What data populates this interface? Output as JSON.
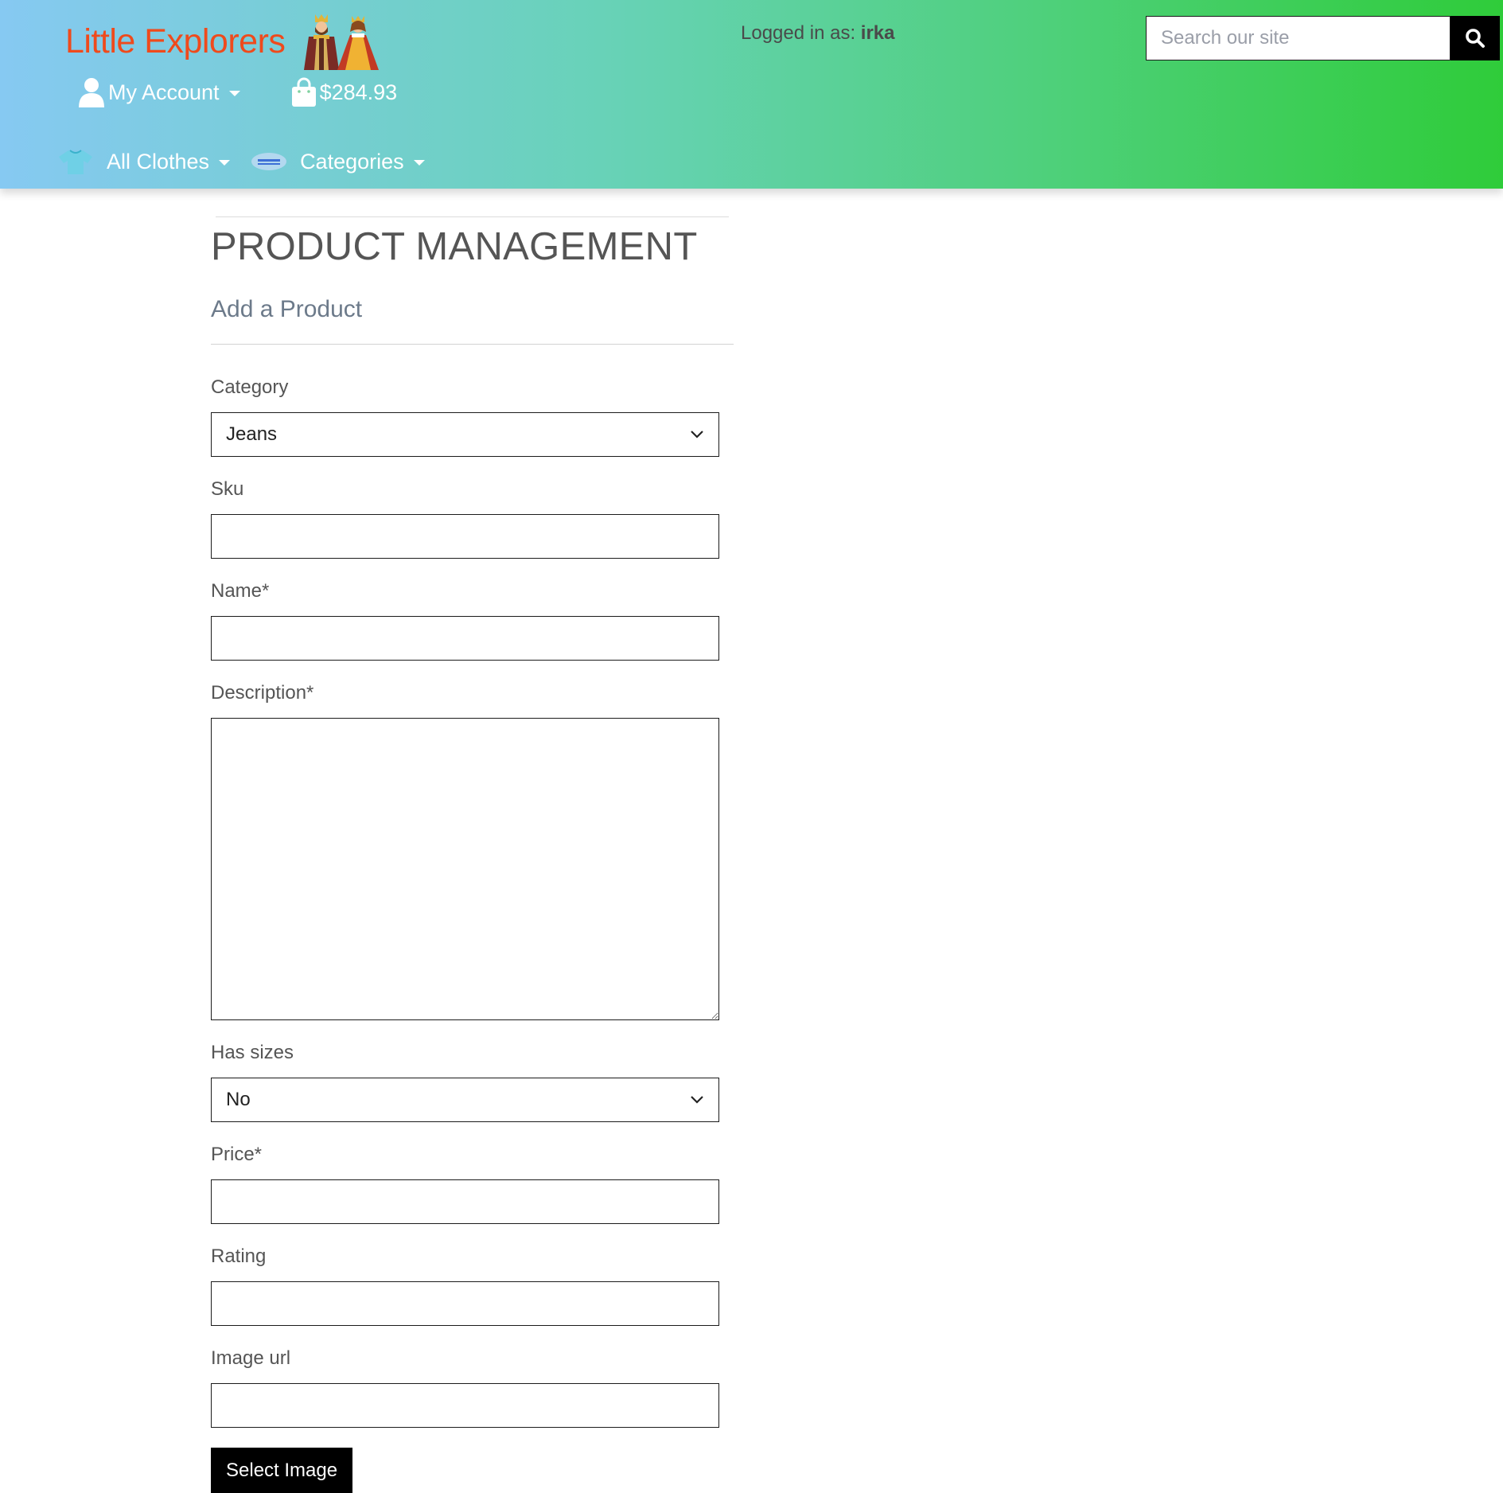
{
  "header": {
    "brand": "Little Explorers",
    "logged_in_label": "Logged in as:",
    "logged_in_user": "irka",
    "search_placeholder": "Search our site",
    "account_label": "My Account",
    "cart_total": "$284.93",
    "nav": {
      "all_clothes": "All Clothes",
      "categories": "Categories"
    },
    "colors": {
      "brand": "#ef4a1c",
      "gradient_start": "#86c9f2",
      "gradient_end": "#2fcc3a"
    }
  },
  "page": {
    "title": "PRODUCT MANAGEMENT",
    "subtitle": "Add a Product"
  },
  "form": {
    "category": {
      "label": "Category",
      "value": "Jeans"
    },
    "sku": {
      "label": "Sku",
      "value": ""
    },
    "name": {
      "label": "Name*",
      "value": ""
    },
    "description": {
      "label": "Description*",
      "value": ""
    },
    "has_sizes": {
      "label": "Has sizes",
      "value": "No"
    },
    "price": {
      "label": "Price*",
      "value": ""
    },
    "rating": {
      "label": "Rating",
      "value": ""
    },
    "image_url": {
      "label": "Image url",
      "value": ""
    },
    "select_image_label": "Select Image"
  },
  "icons": {
    "brand_figures": "king-queen-icon",
    "account": "user-icon",
    "cart": "shopping-bag-icon",
    "search": "search-icon",
    "all_clothes": "tshirt-icon",
    "categories": "jeans-icon"
  }
}
